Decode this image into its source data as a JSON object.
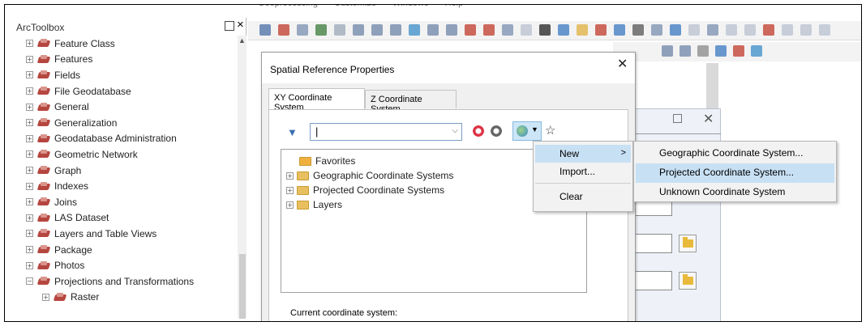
{
  "toolbox": {
    "title": "ArcToolbox",
    "items": [
      {
        "label": "Feature Class",
        "expander": "+"
      },
      {
        "label": "Features",
        "expander": "+"
      },
      {
        "label": "Fields",
        "expander": "+"
      },
      {
        "label": "File Geodatabase",
        "expander": "+"
      },
      {
        "label": "General",
        "expander": "+"
      },
      {
        "label": "Generalization",
        "expander": "+"
      },
      {
        "label": "Geodatabase Administration",
        "expander": "+"
      },
      {
        "label": "Geometric Network",
        "expander": "+"
      },
      {
        "label": "Graph",
        "expander": "+"
      },
      {
        "label": "Indexes",
        "expander": "+"
      },
      {
        "label": "Joins",
        "expander": "+"
      },
      {
        "label": "LAS Dataset",
        "expander": "+"
      },
      {
        "label": "Layers and Table Views",
        "expander": "+"
      },
      {
        "label": "Package",
        "expander": "+"
      },
      {
        "label": "Photos",
        "expander": "+"
      },
      {
        "label": "Projections and Transformations",
        "expander": "−"
      },
      {
        "label": "Raster",
        "expander": "+"
      }
    ]
  },
  "app_menu": [
    "Geoprocessing",
    "Customize",
    "Windows",
    "Help"
  ],
  "dialog": {
    "title": "Spatial Reference Properties",
    "close_glyph": "✕",
    "tabs": {
      "xy": "XY Coordinate System",
      "z": "Z Coordinate System"
    },
    "search_value": "|",
    "tree": [
      {
        "label": "Favorites",
        "expandable": false,
        "icon": "favorites-folder-icon"
      },
      {
        "label": "Geographic Coordinate Systems",
        "expandable": true,
        "icon": "folder-icon"
      },
      {
        "label": "Projected Coordinate Systems",
        "expandable": true,
        "icon": "folder-icon"
      },
      {
        "label": "Layers",
        "expandable": true,
        "icon": "folder-icon"
      }
    ],
    "current_label": "Current coordinate system:"
  },
  "context_menu": {
    "items": [
      {
        "label": "New",
        "submenu": true,
        "highlighted": true
      },
      {
        "label": "Import...",
        "submenu": false,
        "highlighted": false
      },
      {
        "label": "Clear",
        "submenu": false,
        "highlighted": false
      }
    ],
    "submenu_arrow": ">"
  },
  "submenu": {
    "items": [
      {
        "label": "Geographic Coordinate System...",
        "highlighted": false
      },
      {
        "label": "Projected Coordinate System...",
        "highlighted": true
      },
      {
        "label": "Unknown Coordinate System",
        "highlighted": false
      }
    ]
  },
  "behind_dialog": {
    "min_glyph": "☐",
    "close_glyph": "✕"
  },
  "colors": {
    "highlight": "#c7e0f4",
    "toolbox_icon": "#b5463f",
    "folder": "#e8c060"
  }
}
